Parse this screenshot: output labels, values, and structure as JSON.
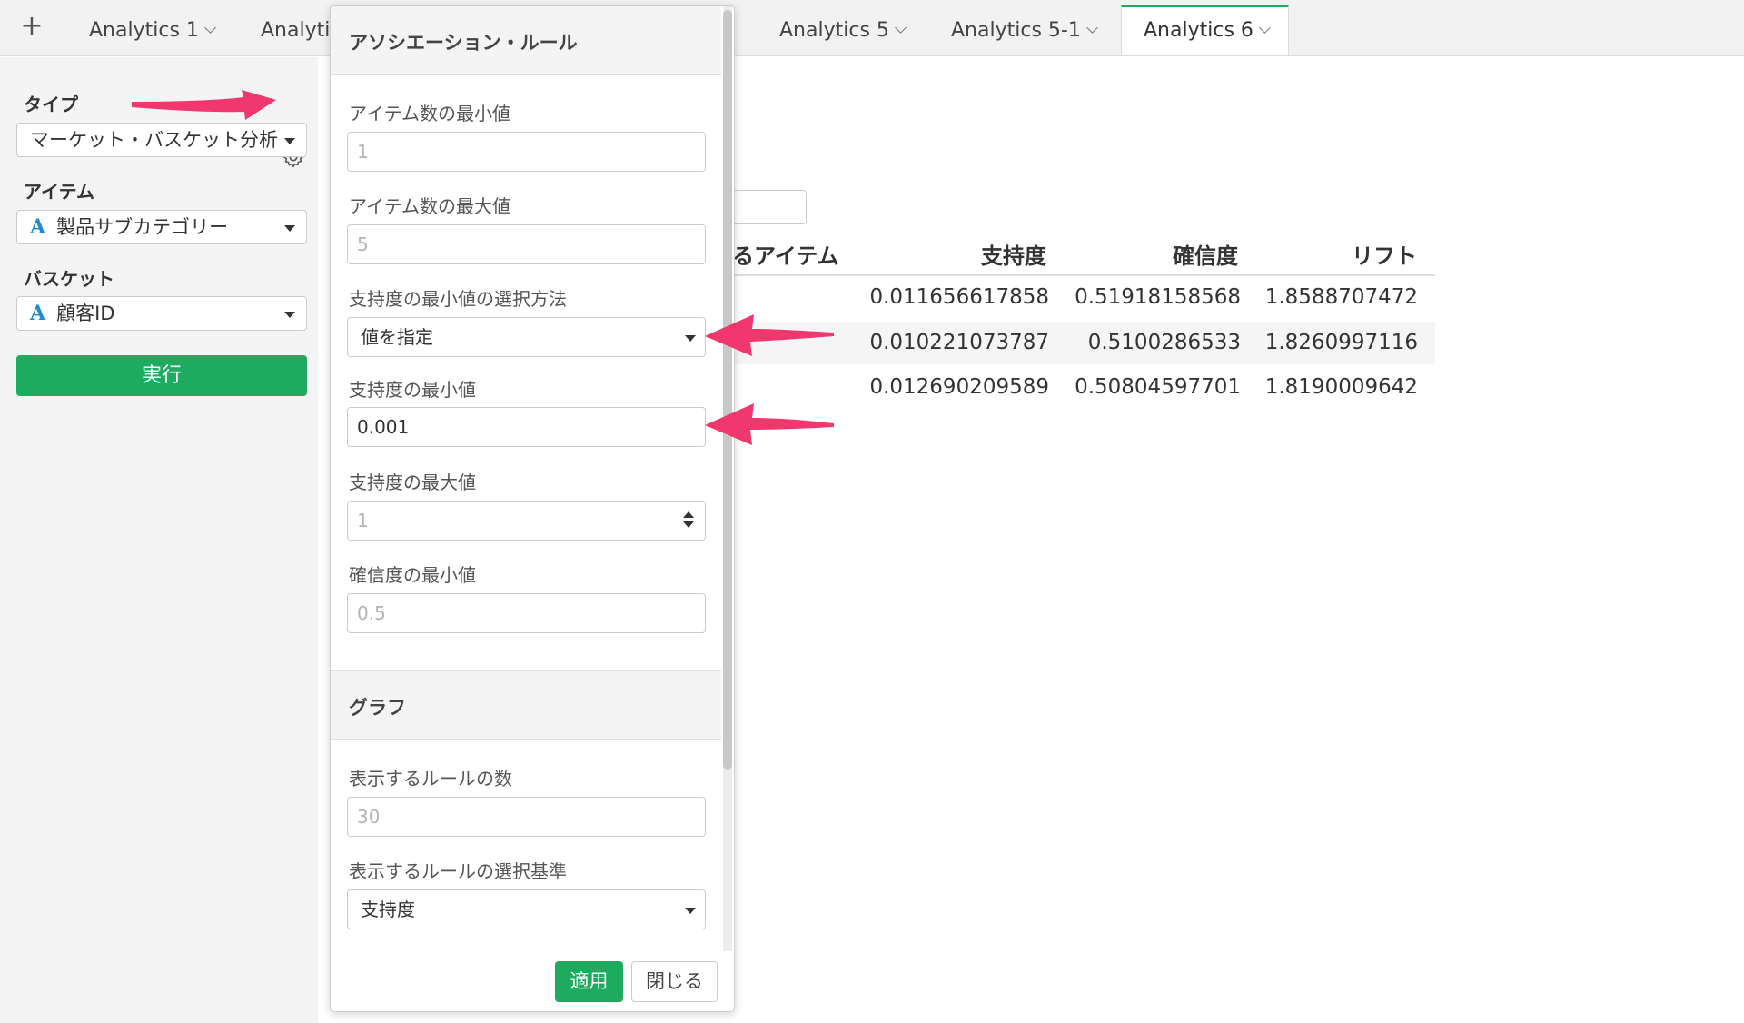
{
  "tabs": {
    "add_label": "+",
    "items": [
      {
        "label": "Analytics 1"
      },
      {
        "label": "Analytic"
      },
      {
        "label": "Analytics 5"
      },
      {
        "label": "Analytics 5-1"
      },
      {
        "label": "Analytics 6"
      }
    ],
    "active_index": 4
  },
  "left_panel": {
    "type_label": "タイプ",
    "type_value": "マーケット・バスケット分析",
    "item_label": "アイテム",
    "item_type_icon": "A",
    "item_value": "製品サブカテゴリー",
    "basket_label": "バスケット",
    "basket_type_icon": "A",
    "basket_value": "顧客ID",
    "run_label": "実行",
    "settings_icon": "gear-icon"
  },
  "table": {
    "headers": [
      "るアイテム",
      "支持度",
      "確信度",
      "リフト"
    ],
    "rows": [
      [
        "0.011656617858",
        "0.51918158568",
        "1.8588707472"
      ],
      [
        "0.010221073787",
        "0.5100286533",
        "1.8260997116"
      ],
      [
        "0.012690209589",
        "0.50804597701",
        "1.8190009642"
      ]
    ]
  },
  "dialog": {
    "section_rules": "アソシエーション・ルール",
    "min_items_label": "アイテム数の最小値",
    "min_items_placeholder": "1",
    "max_items_label": "アイテム数の最大値",
    "max_items_placeholder": "5",
    "support_method_label": "支持度の最小値の選択方法",
    "support_method_value": "値を指定",
    "min_support_label": "支持度の最小値",
    "min_support_value": "0.001",
    "max_support_label": "支持度の最大値",
    "max_support_placeholder": "1",
    "min_confidence_label": "確信度の最小値",
    "min_confidence_placeholder": "0.5",
    "section_graph": "グラフ",
    "rule_count_label": "表示するルールの数",
    "rule_count_placeholder": "30",
    "rule_criteria_label": "表示するルールの選択基準",
    "rule_criteria_value": "支持度",
    "apply_label": "適用",
    "close_label": "閉じる"
  },
  "colors": {
    "accent": "#1eaa5f",
    "annotation_arrow": "#f0376e",
    "type_icon": "#1f8bcf"
  }
}
